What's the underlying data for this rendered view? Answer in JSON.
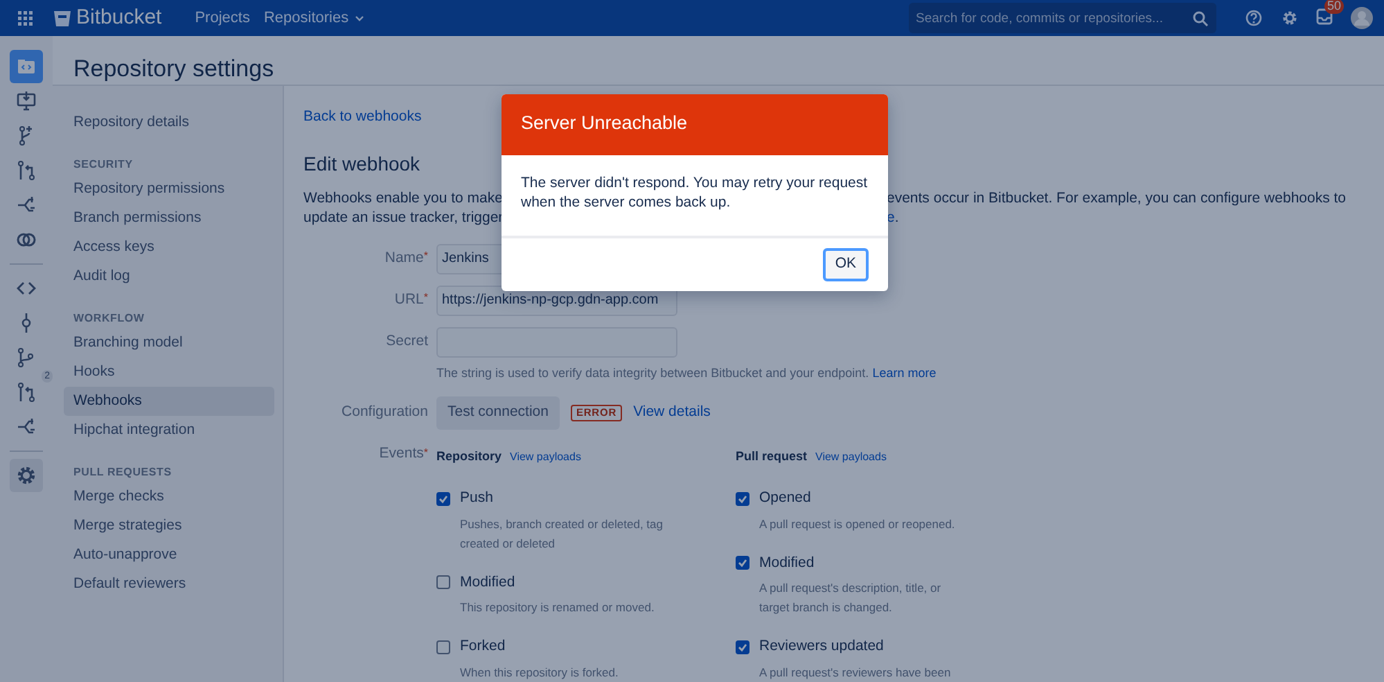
{
  "navbar": {
    "logo": "Bitbucket",
    "links": [
      {
        "label": "Projects",
        "dropdown": false
      },
      {
        "label": "Repositories",
        "dropdown": true
      }
    ],
    "search": {
      "placeholder": "Search for code, commits or repositories..."
    },
    "notification_count": "50"
  },
  "rail": {
    "items": [
      {
        "kind": "repo",
        "selected": true
      },
      {
        "kind": "clone",
        "selected": false
      },
      {
        "kind": "create-branch",
        "selected": false
      },
      {
        "kind": "create-pr",
        "selected": false
      },
      {
        "kind": "fork",
        "selected": false
      },
      {
        "kind": "compare",
        "selected": false
      },
      {
        "kind": "divider"
      },
      {
        "kind": "source",
        "selected": false
      },
      {
        "kind": "commits",
        "selected": false
      },
      {
        "kind": "branches",
        "selected": false
      },
      {
        "kind": "pull-requests",
        "selected": false,
        "badge": "2"
      },
      {
        "kind": "forks",
        "selected": false
      },
      {
        "kind": "divider"
      },
      {
        "kind": "settings",
        "selected": true
      }
    ]
  },
  "page_title": "Repository settings",
  "sidebar": {
    "groups": [
      {
        "items": [
          {
            "label": "Repository details",
            "selected": false
          }
        ]
      },
      {
        "heading": "SECURITY",
        "items": [
          {
            "label": "Repository permissions",
            "selected": false
          },
          {
            "label": "Branch permissions",
            "selected": false
          },
          {
            "label": "Access keys",
            "selected": false
          },
          {
            "label": "Audit log",
            "selected": false
          }
        ]
      },
      {
        "heading": "WORKFLOW",
        "items": [
          {
            "label": "Branching model",
            "selected": false
          },
          {
            "label": "Hooks",
            "selected": false
          },
          {
            "label": "Webhooks",
            "selected": true
          },
          {
            "label": "Hipchat integration",
            "selected": false
          }
        ]
      },
      {
        "heading": "PULL REQUESTS",
        "items": [
          {
            "label": "Merge checks",
            "selected": false
          },
          {
            "label": "Merge strategies",
            "selected": false
          },
          {
            "label": "Auto-unapprove",
            "selected": false
          },
          {
            "label": "Default reviewers",
            "selected": false
          }
        ]
      }
    ]
  },
  "main": {
    "back_link": "Back to webhooks",
    "heading": "Edit webhook",
    "description": {
      "line_1_left": "Webhooks enable you to make",
      "line_1_right": "events occur in Bitbucket. For example, you can configure webhooks to",
      "line_2_left": "update an issue tracker, trigger",
      "line_2_right_link": "e",
      "line_2_right_tail": "."
    },
    "fields": [
      {
        "label": "Name",
        "required_mark": "*",
        "value": "Jenkins"
      },
      {
        "label": "URL",
        "required_mark": "*",
        "value": "https://jenkins-np-gcp.gdn-app.com"
      },
      {
        "label": "Secret",
        "help": "The string is used to verify data integrity between Bitbucket and your endpoint.",
        "help_link": "Learn more"
      }
    ],
    "configuration": {
      "label": "Configuration",
      "button": "Test connection",
      "status": "ERROR",
      "link": "View details"
    },
    "events": {
      "label": "Events",
      "required_mark": "*",
      "columns": [
        {
          "title": "Repository",
          "link": "View payloads",
          "items": [
            {
              "label": "Push",
              "checked": true,
              "description": "Pushes, branch created or deleted, tag created or deleted"
            },
            {
              "label": "Modified",
              "checked": false,
              "description": "This repository is renamed or moved."
            },
            {
              "label": "Forked",
              "checked": false,
              "description": "When this repository is forked."
            }
          ]
        },
        {
          "title": "Pull request",
          "link": "View payloads",
          "items": [
            {
              "label": "Opened",
              "checked": true,
              "description": "A pull request is opened or reopened."
            },
            {
              "label": "Modified",
              "checked": true,
              "description": "A pull request's description, title, or target branch is changed."
            },
            {
              "label": "Reviewers updated",
              "checked": true,
              "description": "A pull request's reviewers have been"
            }
          ]
        }
      ]
    }
  },
  "modal": {
    "title": "Server Unreachable",
    "message": "The server didn't respond. You may retry your request when the server comes back up.",
    "button": "OK"
  }
}
